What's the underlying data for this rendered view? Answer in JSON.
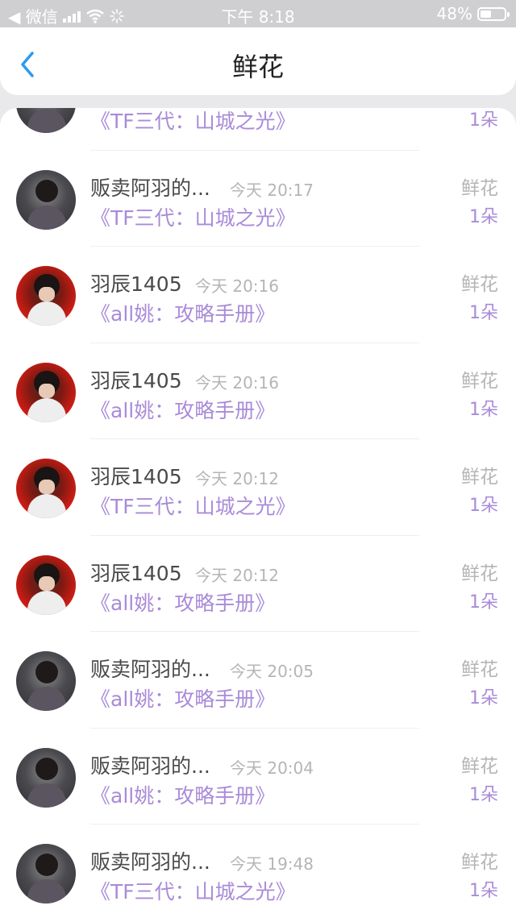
{
  "status_bar": {
    "carrier": "◀ 微信",
    "time": "下午 8:18",
    "battery_text": "48%",
    "battery_level": 0.48
  },
  "nav": {
    "title": "鲜花",
    "back_icon": "chevron-left-icon"
  },
  "rows": [
    {
      "user": "",
      "time": "",
      "book": "《TF三代：山城之光》",
      "gift": "",
      "count": "1朵",
      "avatar": "dark"
    },
    {
      "user": "贩卖阿羽的...",
      "time": "今天 20:17",
      "book": "《TF三代：山城之光》",
      "gift": "鲜花",
      "count": "1朵",
      "avatar": "dark"
    },
    {
      "user": "羽辰1405",
      "time": "今天 20:16",
      "book": "《all姚：攻略手册》",
      "gift": "鲜花",
      "count": "1朵",
      "avatar": "red"
    },
    {
      "user": "羽辰1405",
      "time": "今天 20:16",
      "book": "《all姚：攻略手册》",
      "gift": "鲜花",
      "count": "1朵",
      "avatar": "red"
    },
    {
      "user": "羽辰1405",
      "time": "今天 20:12",
      "book": "《TF三代：山城之光》",
      "gift": "鲜花",
      "count": "1朵",
      "avatar": "red"
    },
    {
      "user": "羽辰1405",
      "time": "今天 20:12",
      "book": "《all姚：攻略手册》",
      "gift": "鲜花",
      "count": "1朵",
      "avatar": "red"
    },
    {
      "user": "贩卖阿羽的...",
      "time": "今天 20:05",
      "book": "《all姚：攻略手册》",
      "gift": "鲜花",
      "count": "1朵",
      "avatar": "dark"
    },
    {
      "user": "贩卖阿羽的...",
      "time": "今天 20:04",
      "book": "《all姚：攻略手册》",
      "gift": "鲜花",
      "count": "1朵",
      "avatar": "dark"
    },
    {
      "user": "贩卖阿羽的...",
      "time": "今天 19:48",
      "book": "《TF三代：山城之光》",
      "gift": "鲜花",
      "count": "1朵",
      "avatar": "dark"
    }
  ],
  "colors": {
    "accent": "#a98bd8",
    "back": "#2a9bf0",
    "muted": "#b5b5b5"
  }
}
